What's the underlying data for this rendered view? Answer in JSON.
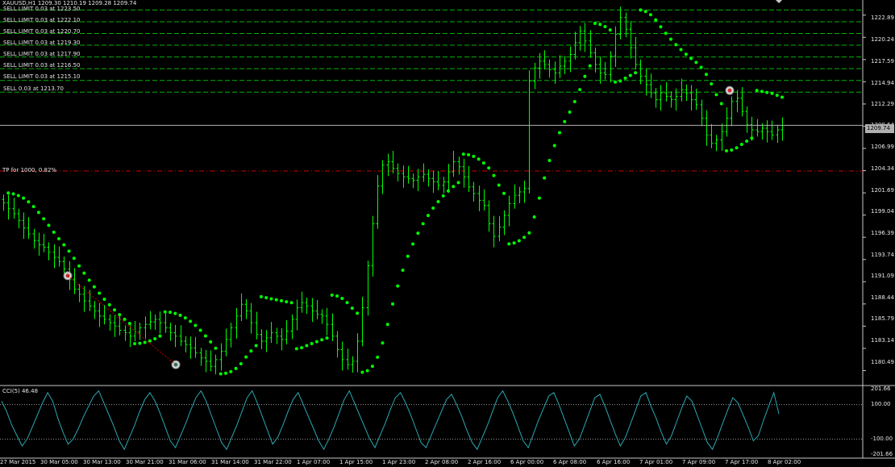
{
  "header": {
    "symbol_line": "XAUUSD,H1  1209.30 1210.19 1209.28 1209.74"
  },
  "orders": [
    {
      "label": "SELL LIMIT 0.03 at 1223.50",
      "price": 1223.5
    },
    {
      "label": "SELL LIMIT 0.03 at 1222.10",
      "price": 1222.1
    },
    {
      "label": "SELL LIMIT 0.03 at 1220.70",
      "price": 1220.7
    },
    {
      "label": "SELL LIMIT 0.03 at 1219.30",
      "price": 1219.3
    },
    {
      "label": "SELL LIMIT 0.03 at 1217.90",
      "price": 1217.9
    },
    {
      "label": "SELL LIMIT 0.03 at 1216.50",
      "price": 1216.5
    },
    {
      "label": "SELL LIMIT 0.03 at 1215.10",
      "price": 1215.1
    },
    {
      "label": "SELL 0.03 at 1213.70",
      "price": 1213.7
    }
  ],
  "tp": {
    "label": "TP for 1000, 0.82%",
    "price": 1204.3
  },
  "bid": {
    "label": "1209.74",
    "price": 1209.74
  },
  "price_axis": [
    "1222.89",
    "1220.24",
    "1217.59",
    "1214.94",
    "1212.29",
    "1209.64",
    "1206.99",
    "1204.34",
    "1201.69",
    "1199.04",
    "1196.39",
    "1193.74",
    "1191.09",
    "1188.44",
    "1185.79",
    "1183.14",
    "1180.49"
  ],
  "indicator": {
    "label": "CCI(5) 46.48",
    "levels": [
      "201.66",
      "100.00",
      "-100.00",
      "-201.66"
    ]
  },
  "time_axis": [
    "27 Mar 2015",
    "30 Mar 05:00",
    "30 Mar 13:00",
    "30 Mar 21:00",
    "31 Mar 06:00",
    "31 Mar 14:00",
    "31 Mar 22:00",
    "1 Apr 07:00",
    "1 Apr 15:00",
    "1 Apr 23:00",
    "2 Apr 08:00",
    "2 Apr 16:00",
    "6 Apr 00:00",
    "6 Apr 08:00",
    "6 Apr 16:00",
    "7 Apr 01:00",
    "7 Apr 09:00",
    "7 Apr 17:00",
    "8 Apr 02:00"
  ],
  "colors": {
    "background": "#000000",
    "candles": "#00ff00",
    "sar": "#00ff00",
    "order_lines": "#00b400",
    "tp_line": "#c80000",
    "cci_line": "#2aa7b0",
    "grid": "#c8c8c8"
  },
  "chart_data": {
    "type": "line",
    "title": "XAUUSD,H1",
    "price_range": [
      1178.9,
      1224.5
    ],
    "cci_range": [
      -201.66,
      201.66
    ],
    "closes": [
      1200.5,
      1199.8,
      1199.2,
      1198.4,
      1197.5,
      1196.8,
      1196.0,
      1195.5,
      1195.2,
      1194.6,
      1194.0,
      1193.5,
      1192.6,
      1191.4,
      1190.2,
      1189.6,
      1188.8,
      1188.2,
      1187.6,
      1187.0,
      1186.6,
      1186.2,
      1185.8,
      1185.3,
      1185.0,
      1184.6,
      1185.1,
      1185.6,
      1186.0,
      1186.3,
      1186.6,
      1186.2,
      1185.6,
      1185.0,
      1184.6,
      1184.0,
      1183.6,
      1183.2,
      1182.6,
      1182.0,
      1181.6,
      1181.0,
      1181.8,
      1182.8,
      1184.2,
      1185.6,
      1187.0,
      1188.4,
      1187.6,
      1186.2,
      1184.8,
      1184.0,
      1184.4,
      1185.0,
      1184.6,
      1184.2,
      1185.2,
      1186.6,
      1188.0,
      1188.6,
      1188.2,
      1187.6,
      1187.2,
      1187.0,
      1186.0,
      1184.6,
      1183.0,
      1181.8,
      1181.2,
      1181.6,
      1184.0,
      1188.0,
      1193.0,
      1198.0,
      1202.5,
      1205.0,
      1205.4,
      1204.6,
      1204.0,
      1203.6,
      1203.4,
      1203.2,
      1203.6,
      1203.9,
      1203.4,
      1203.0,
      1202.6,
      1203.0,
      1204.2,
      1205.4,
      1204.8,
      1203.6,
      1202.4,
      1201.6,
      1200.8,
      1200.2,
      1198.0,
      1196.5,
      1197.6,
      1199.0,
      1200.4,
      1201.4,
      1201.8,
      1202.2,
      1215.0,
      1216.6,
      1217.4,
      1217.0,
      1216.4,
      1216.0,
      1216.8,
      1217.4,
      1218.2,
      1219.6,
      1221.0,
      1219.8,
      1218.4,
      1217.0,
      1216.0,
      1215.8,
      1218.0,
      1220.6,
      1222.6,
      1221.2,
      1219.0,
      1217.0,
      1215.6,
      1214.6,
      1213.6,
      1212.8,
      1213.6,
      1213.2,
      1212.8,
      1213.2,
      1214.0,
      1213.6,
      1212.8,
      1212.2,
      1210.6,
      1208.6,
      1207.6,
      1208.0,
      1209.0,
      1210.6,
      1212.6,
      1213.0,
      1211.4,
      1209.8,
      1209.2,
      1209.0,
      1209.4,
      1209.0,
      1208.6,
      1209.2,
      1209.74
    ],
    "cci_values": [
      120,
      60,
      -20,
      -80,
      -140,
      -100,
      -30,
      40,
      110,
      170,
      120,
      20,
      -60,
      -130,
      -100,
      -40,
      30,
      90,
      150,
      180,
      110,
      40,
      -30,
      -110,
      -160,
      -90,
      -20,
      60,
      130,
      170,
      120,
      50,
      -30,
      -110,
      -150,
      -80,
      -10,
      70,
      140,
      180,
      120,
      40,
      -40,
      -120,
      -160,
      -90,
      -20,
      60,
      140,
      180,
      110,
      30,
      -50,
      -130,
      -90,
      -20,
      60,
      130,
      170,
      100,
      30,
      -40,
      -110,
      -160,
      -100,
      -30,
      50,
      130,
      180,
      110,
      40,
      -30,
      -100,
      -150,
      -80,
      -10,
      70,
      140,
      170,
      110,
      40,
      -40,
      -120,
      -150,
      -80,
      -10,
      60,
      130,
      160,
      100,
      30,
      -50,
      -120,
      -160,
      -90,
      -20,
      60,
      140,
      180,
      120,
      50,
      -30,
      -110,
      -150,
      -70,
      10,
      80,
      150,
      170,
      100,
      20,
      -60,
      -140,
      -100,
      -20,
      60,
      140,
      160,
      90,
      10,
      -70,
      -140,
      -90,
      -10,
      70,
      150,
      170,
      90,
      20,
      -60,
      -130,
      -80,
      0,
      80,
      150,
      120,
      40,
      -40,
      -120,
      -160,
      -90,
      -10,
      70,
      140,
      110,
      40,
      -30,
      -110,
      -80,
      10,
      90,
      170,
      46.48
    ]
  }
}
